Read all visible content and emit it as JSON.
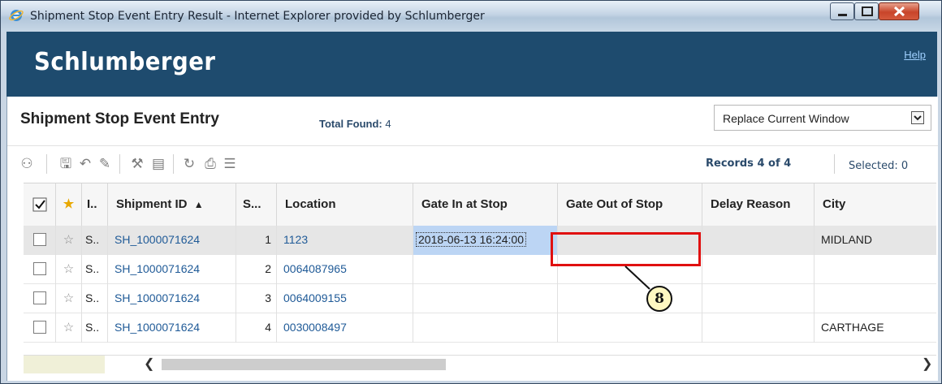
{
  "window": {
    "title": "Shipment Stop Event Entry Result - Internet Explorer provided by Schlumberger"
  },
  "banner": {
    "logo": "Schlumberger",
    "help": "Help"
  },
  "header": {
    "page_title": "Shipment Stop Event Entry",
    "total_label": "Total Found:",
    "total_value": "4",
    "window_mode": "Replace Current Window"
  },
  "toolbar": {
    "icons": [
      "view-icon",
      "save-icon",
      "undo-icon",
      "edit-icon",
      "tools-icon",
      "save-disabled-icon",
      "refresh-icon",
      "print-icon",
      "list-icon"
    ],
    "records": "Records  4  of  4",
    "selected": "Selected: 0"
  },
  "grid": {
    "columns": [
      "",
      "",
      "I..",
      "Shipment ID",
      "S...",
      "Location",
      "Gate In at Stop",
      "Gate Out of Stop",
      "Delay Reason",
      "City"
    ],
    "sort_indicator": "▲",
    "rows": [
      {
        "i": "S..",
        "shipment_id": "SH_1000071624",
        "seq": "1",
        "location": "1123",
        "gate_in": "2018-06-13 16:24:00",
        "gate_out": "",
        "delay": "",
        "city": "MIDLAND"
      },
      {
        "i": "S..",
        "shipment_id": "SH_1000071624",
        "seq": "2",
        "location": "0064087965",
        "gate_in": "",
        "gate_out": "",
        "delay": "",
        "city": ""
      },
      {
        "i": "S..",
        "shipment_id": "SH_1000071624",
        "seq": "3",
        "location": "0064009155",
        "gate_in": "",
        "gate_out": "",
        "delay": "",
        "city": ""
      },
      {
        "i": "S..",
        "shipment_id": "SH_1000071624",
        "seq": "4",
        "location": "0030008497",
        "gate_in": "",
        "gate_out": "",
        "delay": "",
        "city": "CARTHAGE"
      }
    ]
  },
  "annotation": {
    "badge": "8",
    "color": "#e01010"
  }
}
